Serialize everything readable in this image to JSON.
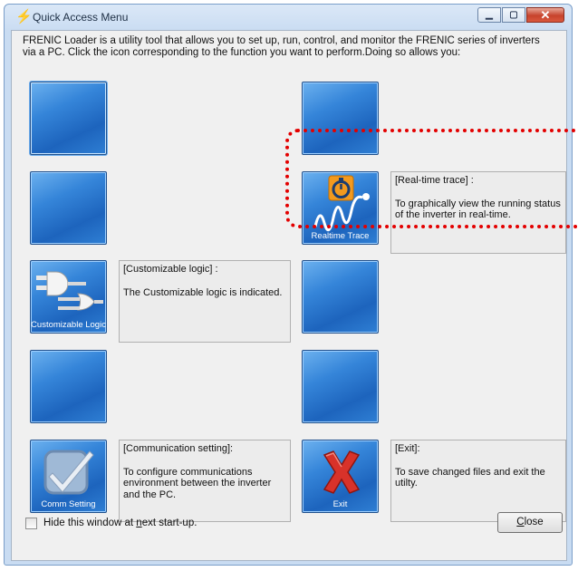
{
  "window": {
    "title": "Quick Access Menu",
    "icon": "lightning-icon"
  },
  "intro_text": "FRENIC Loader is a utility tool that allows you to set up, run, control, and monitor the FRENIC series of inverters via a PC. Click the icon corresponding to the function you want to perform.Doing so allows you:",
  "tiles": {
    "realtime_trace": {
      "label": "Realtime Trace",
      "title": "[Real-time trace] :",
      "desc": "To graphically view the running status of the inverter in real-time."
    },
    "customizable_logic": {
      "label": "Customizable Logic",
      "title": "[Customizable logic] :",
      "desc": "The Customizable logic is indicated."
    },
    "comm_setting": {
      "label": "Comm Setting",
      "title": "[Communication setting]:",
      "desc": "To configure communications environment between the inverter and the PC."
    },
    "exit": {
      "label": "Exit",
      "title": "[Exit]:",
      "desc": "To save changed files and exit the utilty."
    }
  },
  "footer": {
    "checkbox_pre": "Hide this window at ",
    "checkbox_key": "n",
    "checkbox_post": "ext start-up.",
    "checkbox_checked": false,
    "close_key": "C",
    "close_rest": "lose"
  },
  "colors": {
    "tile_blue": "#2a78d0",
    "highlight_red": "#e30000",
    "title_bar": "#c9dcf2"
  }
}
